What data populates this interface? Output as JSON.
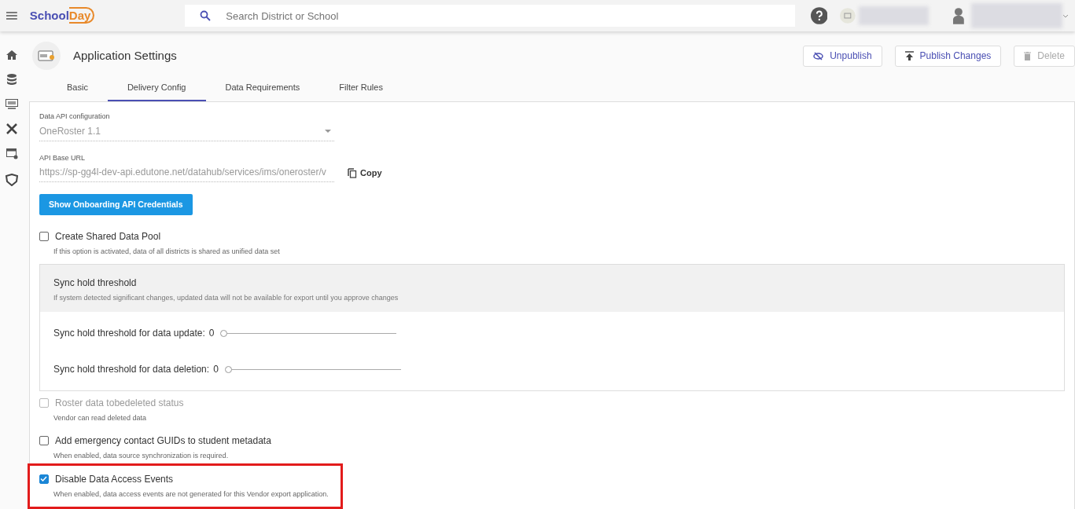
{
  "header": {
    "logo": {
      "part1": "School",
      "part2": "Day"
    },
    "search": {
      "placeholder": "Search District or School"
    }
  },
  "page": {
    "title": "Application Settings",
    "buttons": [
      {
        "label": "Unpublish",
        "kind": "unpublish",
        "disabled": false
      },
      {
        "label": "Publish Changes",
        "kind": "publish",
        "disabled": false
      },
      {
        "label": "Delete",
        "kind": "delete",
        "disabled": true
      }
    ]
  },
  "tabs": [
    {
      "label": "Basic",
      "selected": false
    },
    {
      "label": "Delivery Config",
      "selected": true
    },
    {
      "label": "Data Requirements",
      "selected": false
    },
    {
      "label": "Filter Rules",
      "selected": false
    }
  ],
  "form": {
    "api_config": {
      "label": "Data API configuration",
      "value": "OneRoster 1.1"
    },
    "base_url": {
      "label": "API Base URL",
      "value": "https://sp-gg4l-dev-api.edutone.net/datahub/services/ims/oneroster/v",
      "copy_label": "Copy"
    },
    "credentials_button": "Show Onboarding API Credentials"
  },
  "options_top": [
    {
      "label": "Create Shared Data Pool",
      "hint": "If this option is activated, data of all districts is shared as unified data set",
      "checked": false,
      "disabled": false,
      "highlighted": false
    }
  ],
  "sync_panel": {
    "title": "Sync hold threshold",
    "hint": "If system detected significant changes, updated data will not be available for export until you approve changes",
    "sliders": [
      {
        "label": "Sync hold threshold for data update:",
        "reading": "0",
        "level": 0
      },
      {
        "label": "Sync hold threshold for data deletion:",
        "reading": "0",
        "level": 0
      }
    ]
  },
  "options": [
    {
      "label": "Roster data tobedeleted status",
      "hint": "Vendor can read deleted data",
      "checked": false,
      "disabled": true,
      "highlighted": false
    },
    {
      "label": "Add emergency contact GUIDs to student metadata",
      "hint": "When enabled, data source synchronization is required.",
      "checked": false,
      "disabled": false,
      "highlighted": false
    },
    {
      "label": "Disable Data Access Events",
      "hint": "When enabled, data access events are not generated for this Vendor export application.",
      "checked": true,
      "disabled": false,
      "highlighted": true
    }
  ]
}
